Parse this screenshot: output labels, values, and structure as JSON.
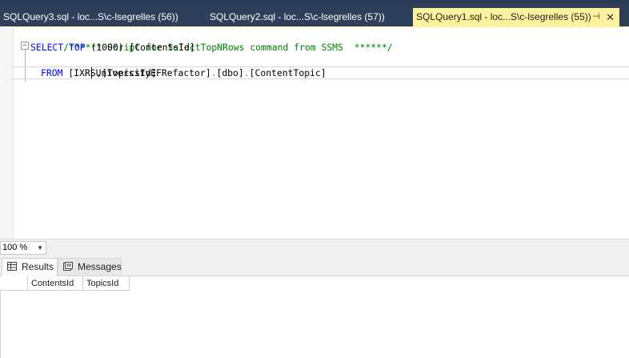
{
  "tabs": [
    {
      "label": "SQLQuery3.sql - loc...S\\c-lsegrelles (56))",
      "active": false
    },
    {
      "label": "SQLQuery2.sql - loc...S\\c-lsegrelles (57))",
      "active": false
    },
    {
      "label": "SQLQuery1.sql - loc...S\\c-lsegrelles (55))",
      "active": true
    }
  ],
  "tab_icons": {
    "pin": "pin-icon",
    "close": "close-icon"
  },
  "editor": {
    "comment": "/****** Script for SelectTopNRows command from SSMS  ******/",
    "line2": {
      "kw_select": "SELECT",
      "kw_top": "TOP",
      "rest": " (1000) [ContentsId]"
    },
    "line3": "      ,[TopicsId]",
    "line4": {
      "kw_from": "FROM",
      "table": "[IXRSUniversityEFRefactor]",
      "dot1": ".",
      "schema": "[dbo]",
      "dot2": ".",
      "name": "[ContentTopic]"
    }
  },
  "zoom": {
    "value": "100 %"
  },
  "results": {
    "tabs": [
      {
        "label": "Results",
        "icon": "grid-icon"
      },
      {
        "label": "Messages",
        "icon": "messages-icon"
      }
    ],
    "columns": [
      "ContentsId",
      "TopicsId"
    ]
  },
  "colors": {
    "tab_bar": "#2f3f5a",
    "active_tab": "#fff29d",
    "comment": "#008000",
    "keyword": "#0000ff"
  }
}
